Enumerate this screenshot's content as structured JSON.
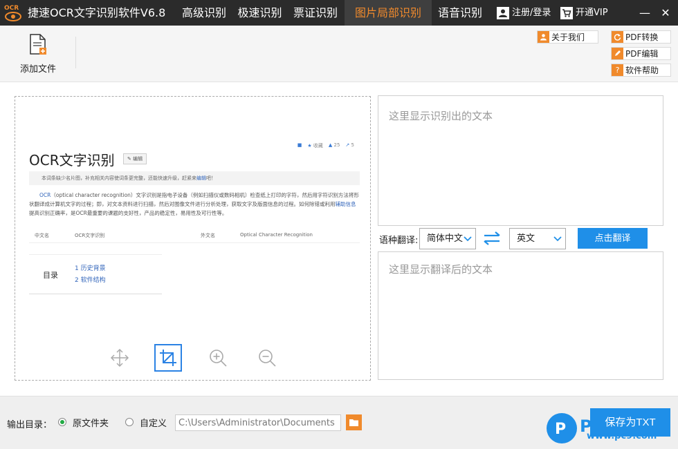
{
  "titlebar": {
    "title": "捷速OCR文字识别软件V6.8",
    "logo_text": "OCR",
    "tabs": [
      {
        "label": "高级识别"
      },
      {
        "label": "极速识别"
      },
      {
        "label": "票证识别"
      },
      {
        "label": "图片局部识别",
        "active": true
      },
      {
        "label": "语音识别"
      }
    ],
    "login_label": "注册/登录",
    "vip_label": "开通VIP",
    "minimize": "—",
    "close": "✕"
  },
  "toolbar": {
    "add_file_label": "添加文件",
    "about_label": "关于我们",
    "pdf_convert_label": "PDF转换",
    "pdf_edit_label": "PDF编辑",
    "help_label": "软件帮助"
  },
  "document": {
    "title": "OCR文字识别",
    "edit_label": "编辑",
    "actions": [
      "收藏",
      "25",
      "5"
    ],
    "notice_text": "本词条缺少名片图，补充相关内容使词条更完整，还能快速升级，赶紧来",
    "notice_link": "编辑",
    "notice_end": "吧！",
    "body_lead": "OCR",
    "body_text": "（optical character recognition）文字识别是指电子设备（例如扫描仪或数码相机）检查纸上打印的字符，然后用字符识别方法将形状翻译成计算机文字的过程；即，对文本资料进行扫描，然后对图像文件进行分析处理，获取文字及版面信息的过程。如何除错或利用",
    "body_link": "辅助信息",
    "body_end": "提高识别正确率，是OCR最重要的课题的支好性，产品的稳定性，易用性及可行性等。",
    "table": {
      "label1": "中文名",
      "value1": "OCR文字识别",
      "label2": "外文名",
      "value2": "Optical Character Recognition"
    },
    "toc_label": "目录",
    "toc_items": [
      "1  历史背景",
      "2  软件结构"
    ]
  },
  "ocr_placeholder": "这里显示识别出的文本",
  "translate": {
    "label": "语种翻译:",
    "source": "简体中文",
    "target": "英文",
    "button": "点击翻译",
    "placeholder": "这里显示翻译后的文本"
  },
  "bottom": {
    "output_label": "输出目录：",
    "option_original": "原文件夹",
    "option_custom": "自定义",
    "path": "C:\\Users\\Administrator\\Documents",
    "save_button": "保存为TXT",
    "watermark": "www.pc9.com",
    "watermark_logo": "PC"
  },
  "colors": {
    "titlebar": "#2b2b2b",
    "accent_orange": "#f08a2c",
    "accent_blue": "#1f8fe8"
  }
}
